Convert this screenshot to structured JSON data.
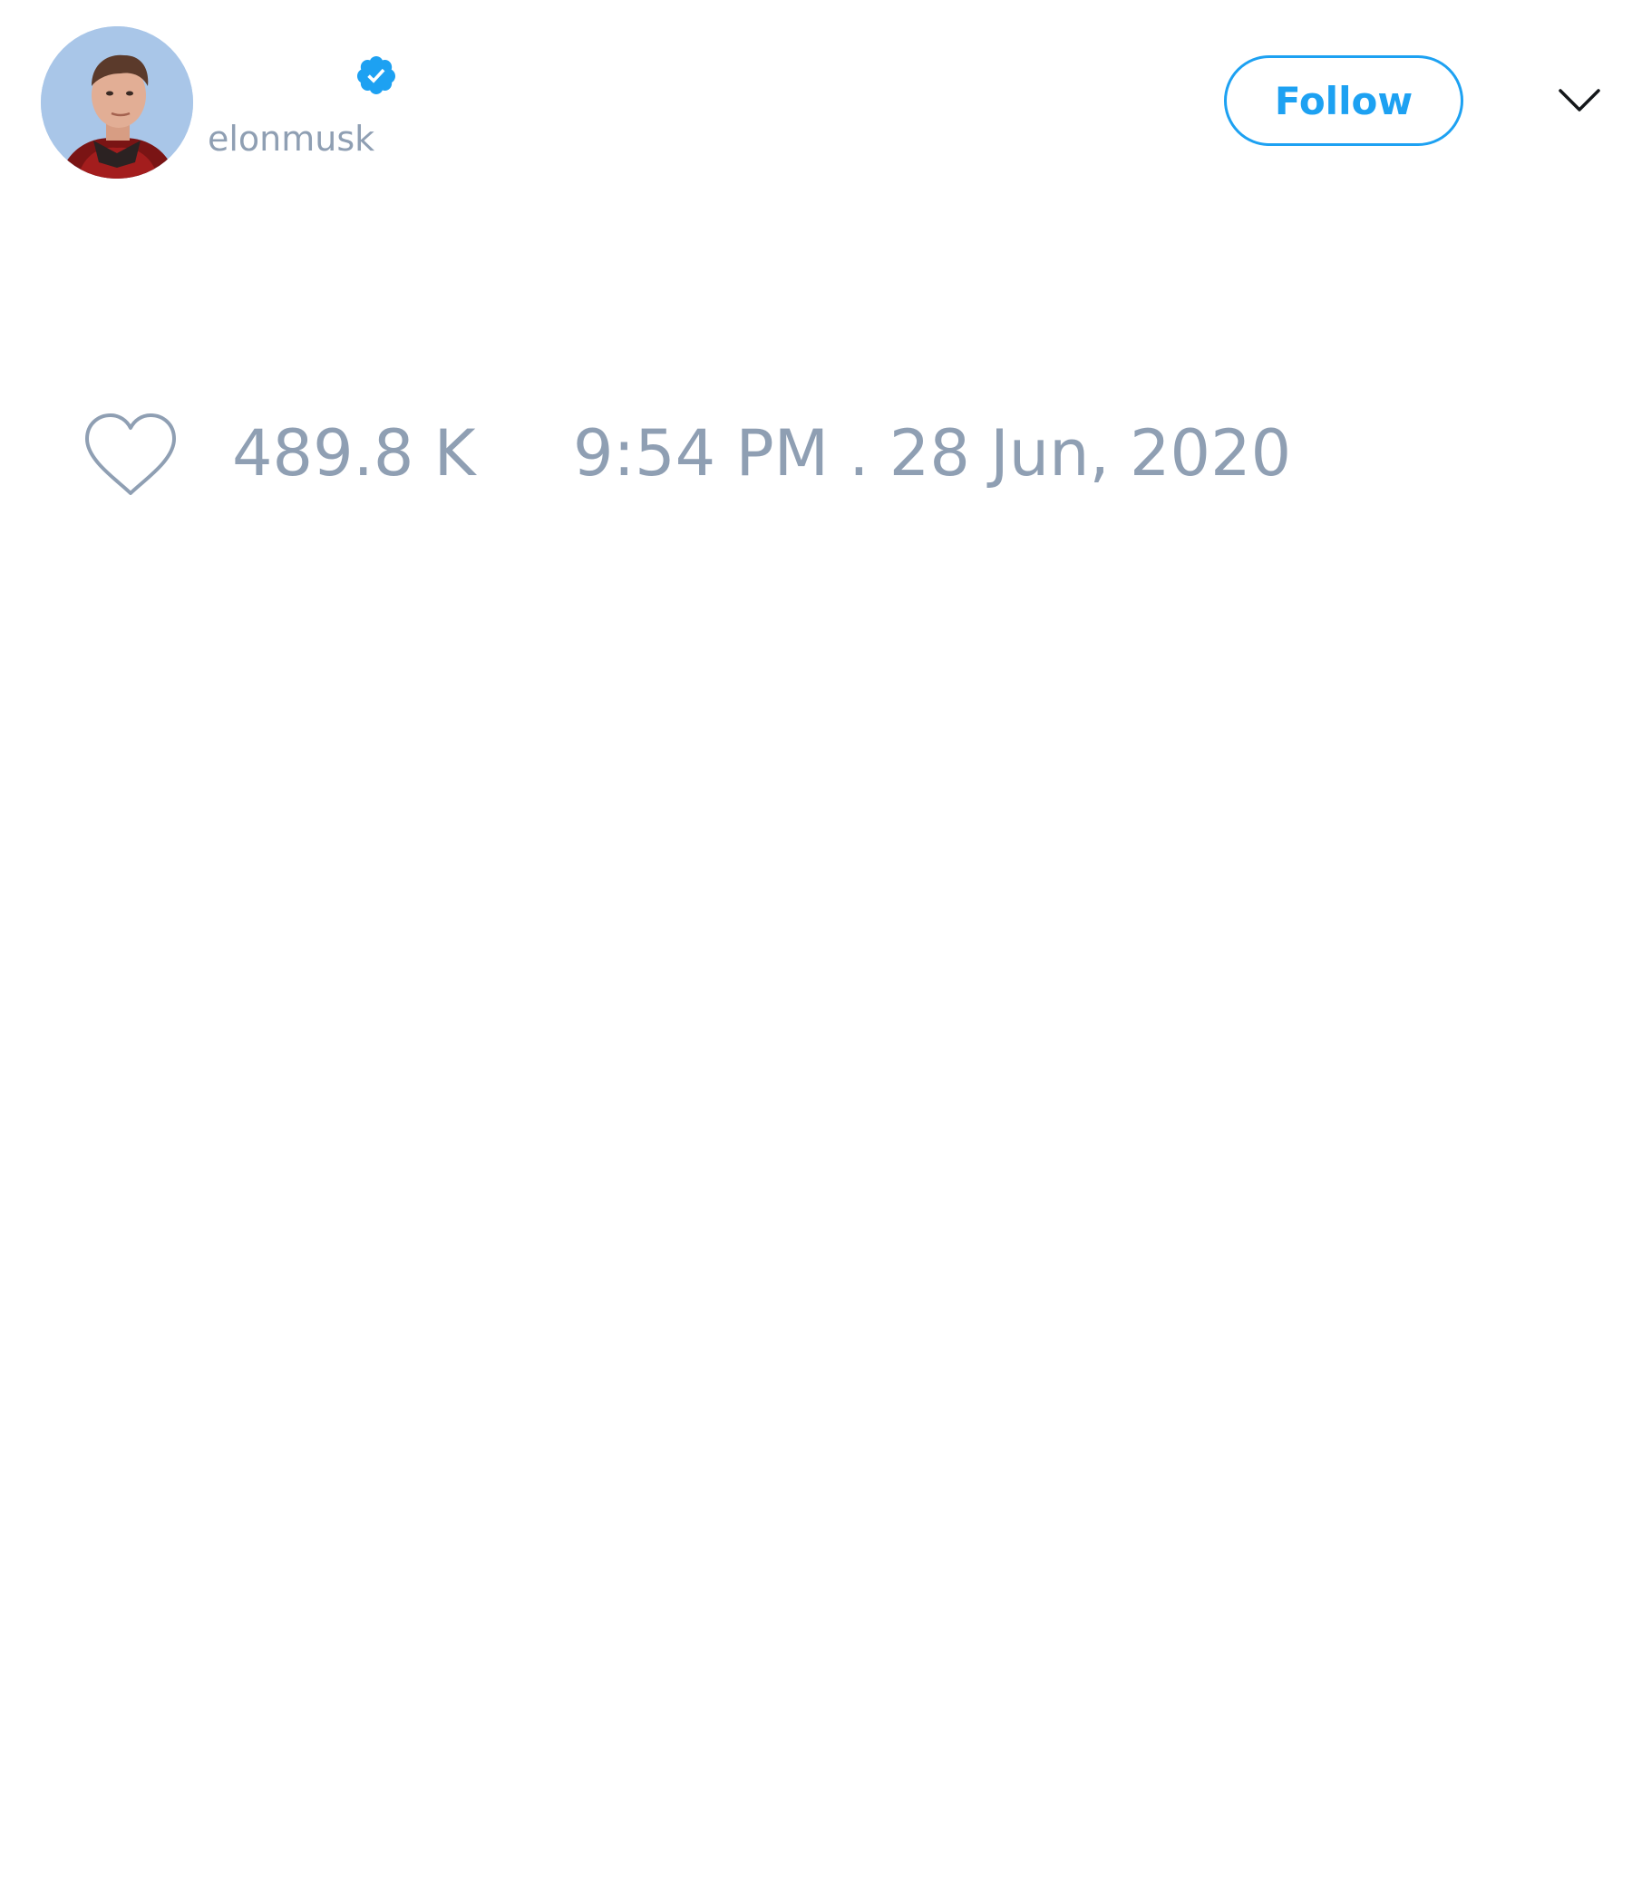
{
  "tweet": {
    "author": {
      "display_name": "",
      "handle": "elonmusk",
      "verified": true,
      "avatar_icon": "profile-photo"
    },
    "follow_label": "Follow",
    "menu_icon": "chevron-down-icon",
    "like_icon": "heart-icon",
    "like_count": "489.8 K",
    "timestamp": "9:54 PM . 28 Jun, 2020"
  },
  "colors": {
    "accent": "#1da1f2",
    "muted_text": "#8f9fb3",
    "icon_stroke": "#8f9fb3",
    "background": "#ffffff"
  }
}
